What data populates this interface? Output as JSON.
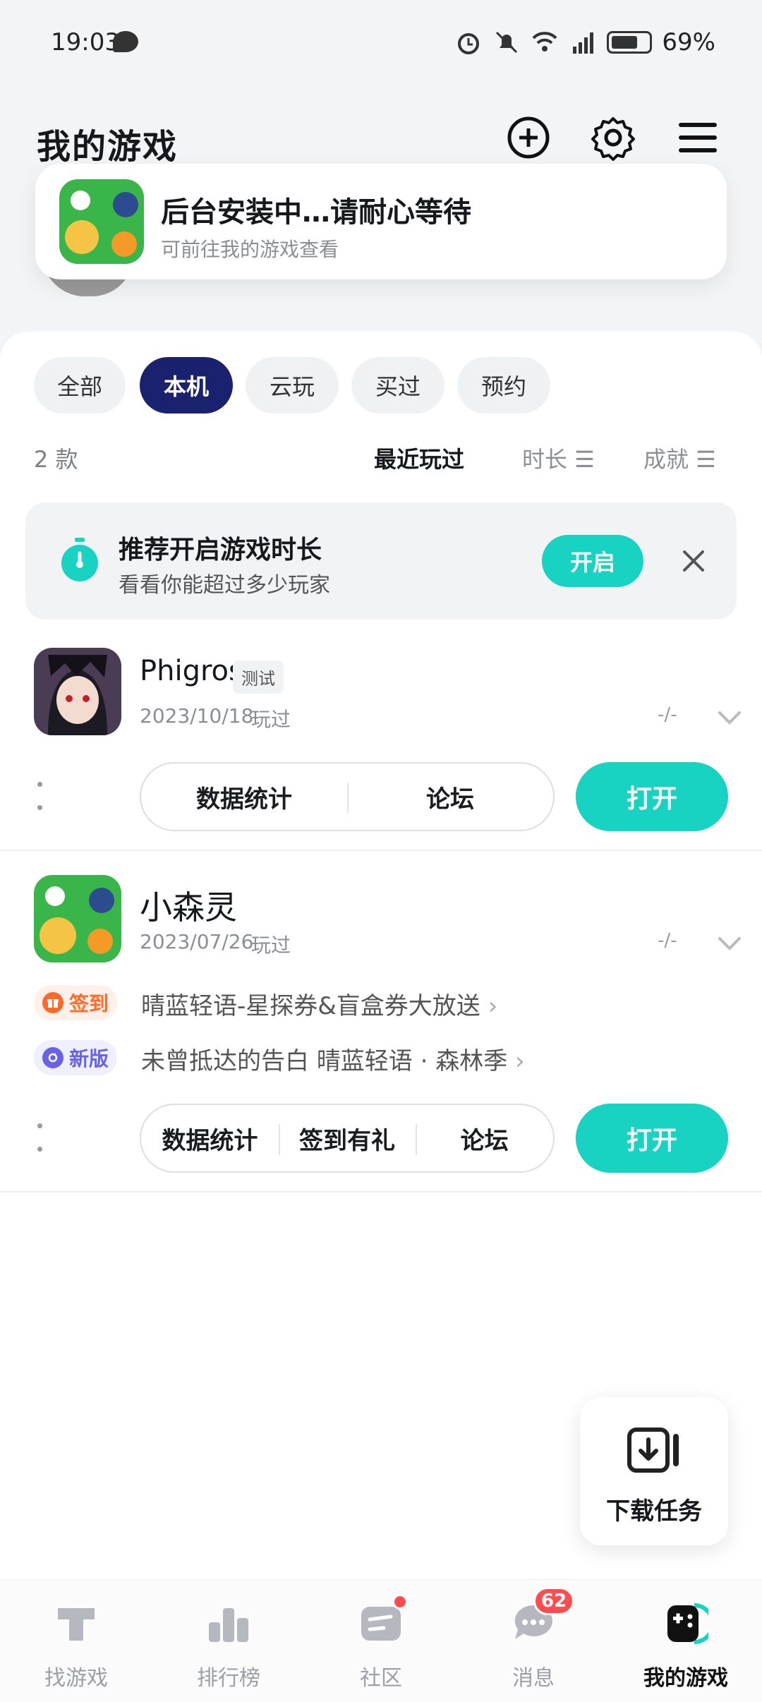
{
  "status_bar": {
    "time": "19:03",
    "battery": "69%"
  },
  "header": {
    "title": "我的游戏"
  },
  "toast": {
    "title": "后台安装中…请耐心等待",
    "subtitle": "可前往我的游戏查看"
  },
  "filters": {
    "chips": [
      "全部",
      "本机",
      "云玩",
      "买过",
      "预约"
    ],
    "active_index": 1,
    "count": "2 款",
    "sort_recent": "最近玩过",
    "sort_duration": "时长 ☰",
    "sort_achievement": "成就 ☰"
  },
  "recommend": {
    "title": "推荐开启游戏时长",
    "subtitle": "看看你能超过多少玩家",
    "button": "开启"
  },
  "games": [
    {
      "name": "Phigros",
      "tag": "测试",
      "date": "2023/10/18",
      "played": "玩过",
      "dash": "-/-",
      "actions": [
        "数据统计",
        "论坛"
      ],
      "open_label": "打开"
    },
    {
      "name": "小森灵",
      "date": "2023/07/26",
      "played": "玩过",
      "dash": "-/-",
      "promos": [
        {
          "badge": "签到",
          "text": "晴蓝轻语-星探券&盲盒券大放送"
        },
        {
          "badge": "新版",
          "text": "未曾抵达的告白 晴蓝轻语 · 森林季"
        }
      ],
      "actions": [
        "数据统计",
        "签到有礼",
        "论坛"
      ],
      "open_label": "打开"
    }
  ],
  "fab": {
    "label": "下载任务"
  },
  "nav": {
    "items": [
      "找游戏",
      "排行榜",
      "社区",
      "消息",
      "我的游戏"
    ],
    "active_index": 4,
    "message_count": "62"
  },
  "colors": {
    "accent": "#18d3c2",
    "chip_active": "#1a2270",
    "badge_red": "#ff4d4f"
  }
}
